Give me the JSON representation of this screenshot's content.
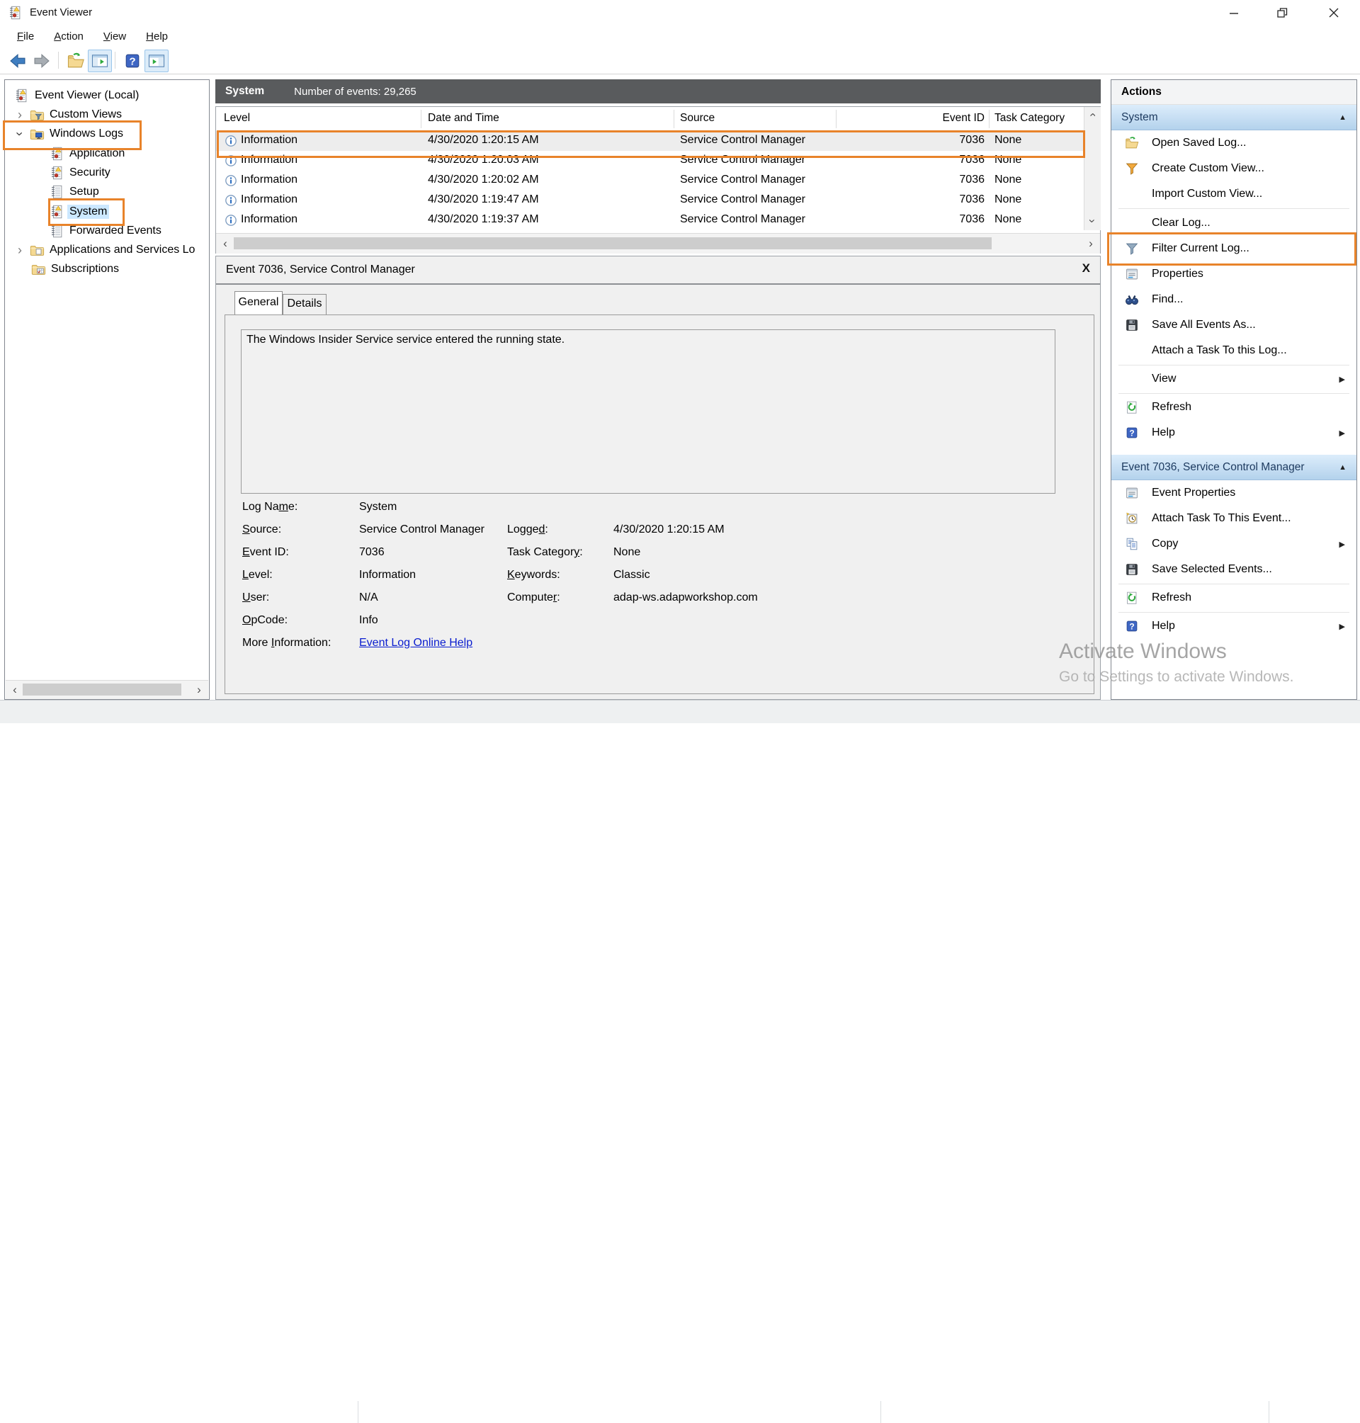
{
  "window": {
    "title": "Event Viewer"
  },
  "menu": {
    "items": [
      "[F]ile",
      "[A]ction",
      "[V]iew",
      "[H]elp"
    ]
  },
  "toolbar": {
    "buttons": [
      "back",
      "forward",
      "open-saved-log",
      "show-console-tree",
      "help",
      "show-action-pane"
    ]
  },
  "tree": {
    "root_label": "Event Viewer (Local)",
    "items": [
      {
        "label": "Custom Views"
      },
      {
        "label": "Windows Logs"
      },
      {
        "label": "Application"
      },
      {
        "label": "Security"
      },
      {
        "label": "Setup"
      },
      {
        "label": "System",
        "selected": true
      },
      {
        "label": "Forwarded Events"
      },
      {
        "label": "Applications and Services Lo"
      },
      {
        "label": "Subscriptions"
      }
    ]
  },
  "list": {
    "title": "System",
    "subtitle": "Number of events: 29,265",
    "columns": [
      "Level",
      "Date and Time",
      "Source",
      "Event ID",
      "Task Category"
    ],
    "rows": [
      {
        "level": "Information",
        "datetime": "4/30/2020 1:20:15 AM",
        "source": "Service Control Manager",
        "event_id": "7036",
        "task_category": "None",
        "selected": true
      },
      {
        "level": "Information",
        "datetime": "4/30/2020 1:20:03 AM",
        "source": "Service Control Manager",
        "event_id": "7036",
        "task_category": "None"
      },
      {
        "level": "Information",
        "datetime": "4/30/2020 1:20:02 AM",
        "source": "Service Control Manager",
        "event_id": "7036",
        "task_category": "None"
      },
      {
        "level": "Information",
        "datetime": "4/30/2020 1:19:47 AM",
        "source": "Service Control Manager",
        "event_id": "7036",
        "task_category": "None"
      },
      {
        "level": "Information",
        "datetime": "4/30/2020 1:19:37 AM",
        "source": "Service Control Manager",
        "event_id": "7036",
        "task_category": "None"
      }
    ]
  },
  "detail": {
    "title": "Event 7036, Service Control Manager",
    "tabs": [
      "General",
      "Details"
    ],
    "description": "The Windows Insider Service service entered the running state.",
    "fields_left": [
      {
        "label": "Log Na[m]e:",
        "value": "System"
      },
      {
        "label": "[S]ource:",
        "value": "Service Control Manager"
      },
      {
        "label": "[E]vent ID:",
        "value": "7036"
      },
      {
        "label": "[L]evel:",
        "value": "Information"
      },
      {
        "label": "[U]ser:",
        "value": "N/A"
      },
      {
        "label": "[O]pCode:",
        "value": "Info"
      },
      {
        "label": "More [I]nformation:",
        "value": "Event Log Online Help"
      }
    ],
    "fields_right": [
      {
        "label": "Logge[d]:",
        "value": "4/30/2020 1:20:15 AM"
      },
      {
        "label": "Task Categor[y]:",
        "value": "None"
      },
      {
        "label": "[K]eywords:",
        "value": "Classic"
      },
      {
        "label": "Compute[r]:",
        "value": "adap-ws.adapworkshop.com"
      }
    ]
  },
  "actions": {
    "title": "Actions",
    "sections": [
      {
        "header": "System",
        "items": [
          {
            "label": "Open Saved Log...",
            "icon": "open-saved-log-icon"
          },
          {
            "label": "Create Custom View...",
            "icon": "create-custom-view-funnel-icon"
          },
          {
            "label": "Import Custom View...",
            "icon": ""
          },
          {
            "label": "Clear Log...",
            "icon": ""
          },
          {
            "label": "Filter Current Log...",
            "icon": "filter-funnel-icon"
          },
          {
            "label": "Properties",
            "icon": "properties-icon"
          },
          {
            "label": "Find...",
            "icon": "binoculars-icon"
          },
          {
            "label": "Save All Events As...",
            "icon": "save-icon"
          },
          {
            "label": "Attach a Task To this Log...",
            "icon": ""
          },
          {
            "label": "View",
            "icon": "",
            "submenu": true
          },
          {
            "label": "Refresh",
            "icon": "refresh-icon"
          },
          {
            "label": "Help",
            "icon": "help-icon",
            "submenu": true
          }
        ]
      },
      {
        "header": "Event 7036, Service Control Manager",
        "items": [
          {
            "label": "Event Properties",
            "icon": "properties-icon"
          },
          {
            "label": "Attach Task To This Event...",
            "icon": "attach-task-icon"
          },
          {
            "label": "Copy",
            "icon": "copy-icon",
            "submenu": true
          },
          {
            "label": "Save Selected Events...",
            "icon": "save-icon"
          },
          {
            "label": "Refresh",
            "icon": "refresh-icon"
          },
          {
            "label": "Help",
            "icon": "help-icon",
            "submenu": true
          }
        ]
      }
    ]
  },
  "watermark": {
    "line1": "Activate Windows",
    "line2": "Go to Settings to activate Windows."
  },
  "annotations": {
    "color": "#e8832a",
    "targets": [
      "windows-logs-tree-item",
      "system-tree-item",
      "selected-event-row",
      "filter-current-log-action"
    ]
  }
}
